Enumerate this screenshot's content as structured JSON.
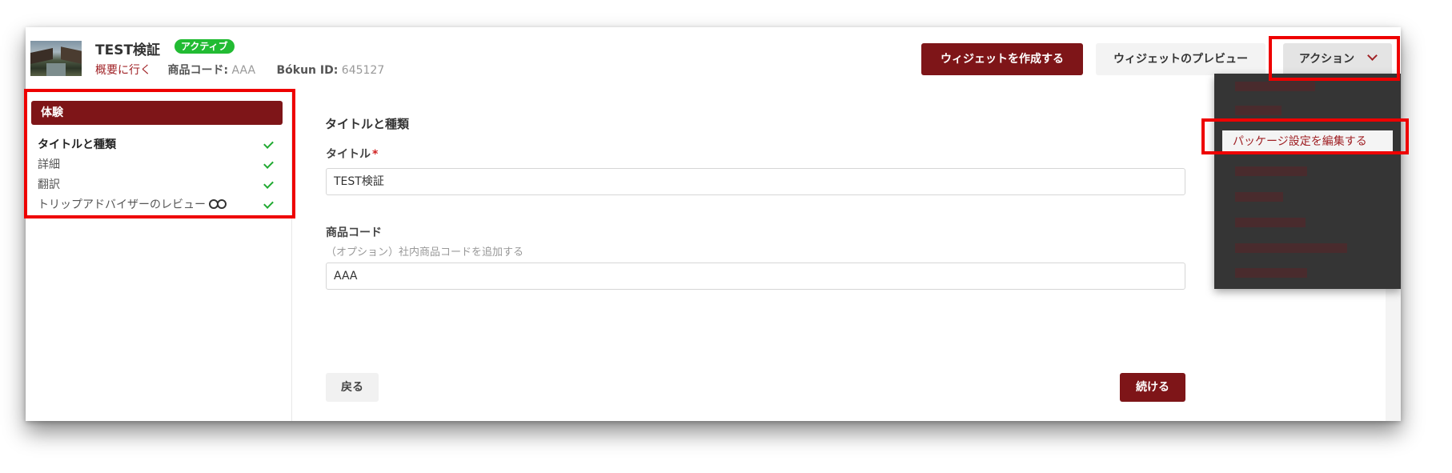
{
  "header": {
    "product_title": "TEST検証",
    "status_badge": "アクティブ",
    "overview_link": "概要に行く",
    "product_code_label": "商品コード:",
    "product_code_value": "AAA",
    "bokun_id_label": "Bókun ID:",
    "bokun_id_value": "645127",
    "create_widget_label": "ウィジェットを作成する",
    "preview_widget_label": "ウィジェットのプレビュー",
    "action_label": "アクション"
  },
  "action_menu": {
    "items": [
      "",
      "",
      "パッケージ設定を編集する",
      "",
      "",
      "",
      "",
      ""
    ],
    "highlighted_index": 2
  },
  "sidebar": {
    "section_title": "体験",
    "items": [
      {
        "label": "タイトルと種類",
        "complete": true,
        "active": true
      },
      {
        "label": "詳細",
        "complete": true
      },
      {
        "label": "翻訳",
        "complete": true
      },
      {
        "label": "トリップアドバイザーのレビュー",
        "complete": true,
        "icon": "tripadvisor-owl-icon"
      }
    ]
  },
  "main": {
    "section_title": "タイトルと種類",
    "title_field": {
      "label": "タイトル",
      "required_mark": "*",
      "value": "TEST検証"
    },
    "code_field": {
      "label": "商品コード",
      "help": "（オプション）社内商品コードを追加する",
      "value": "AAA"
    },
    "back_label": "戻る",
    "continue_label": "続ける"
  },
  "colors": {
    "brand": "#7e1518",
    "badge": "#22bb33",
    "annotation_outline": "#ee0000",
    "menu_background": "#353535"
  }
}
